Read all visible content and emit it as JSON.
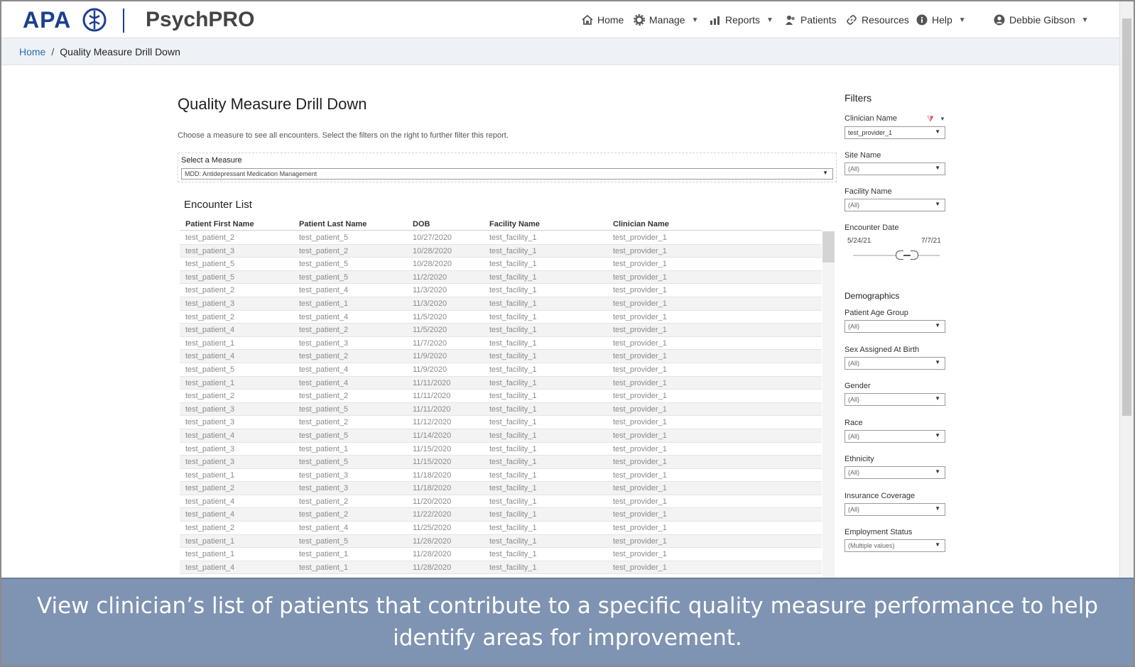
{
  "navbar": {
    "brand_apa": "APA",
    "brand_product": "PsychPRO",
    "items": [
      {
        "label": "Home",
        "icon": "home-icon",
        "dropdown": false
      },
      {
        "label": "Manage",
        "icon": "gear-icon",
        "dropdown": true
      },
      {
        "label": "Reports",
        "icon": "bar-chart-icon",
        "dropdown": true
      },
      {
        "label": "Patients",
        "icon": "users-icon",
        "dropdown": false
      },
      {
        "label": "Resources",
        "icon": "link-icon",
        "dropdown": false
      },
      {
        "label": "Help",
        "icon": "info-icon",
        "dropdown": true
      }
    ],
    "user": {
      "label": "Debbie Gibson",
      "icon": "user-circle-icon"
    }
  },
  "breadcrumb": {
    "home": "Home",
    "separator": "/",
    "current": "Quality Measure Drill Down"
  },
  "main": {
    "title": "Quality Measure Drill Down",
    "description": "Choose a measure to see all encounters. Select the filters on the right to further filter this report.",
    "measure_label": "Select a Measure",
    "measure_value": "MDD: Antidepressant Medication Management",
    "encounter_title": "Encounter List",
    "columns": [
      "Patient First Name",
      "Patient Last Name",
      "DOB",
      "Facility Name",
      "Clinician Name"
    ],
    "rows": [
      [
        "test_patient_2",
        "test_patient_5",
        "10/27/2020",
        "test_facility_1",
        "test_provider_1"
      ],
      [
        "test_patient_3",
        "test_patient_2",
        "10/28/2020",
        "test_facility_1",
        "test_provider_1"
      ],
      [
        "test_patient_5",
        "test_patient_5",
        "10/28/2020",
        "test_facility_1",
        "test_provider_1"
      ],
      [
        "test_patient_5",
        "test_patient_5",
        "11/2/2020",
        "test_facility_1",
        "test_provider_1"
      ],
      [
        "test_patient_2",
        "test_patient_4",
        "11/3/2020",
        "test_facility_1",
        "test_provider_1"
      ],
      [
        "test_patient_3",
        "test_patient_1",
        "11/3/2020",
        "test_facility_1",
        "test_provider_1"
      ],
      [
        "test_patient_2",
        "test_patient_4",
        "11/5/2020",
        "test_facility_1",
        "test_provider_1"
      ],
      [
        "test_patient_4",
        "test_patient_2",
        "11/5/2020",
        "test_facility_1",
        "test_provider_1"
      ],
      [
        "test_patient_1",
        "test_patient_3",
        "11/7/2020",
        "test_facility_1",
        "test_provider_1"
      ],
      [
        "test_patient_4",
        "test_patient_2",
        "11/9/2020",
        "test_facility_1",
        "test_provider_1"
      ],
      [
        "test_patient_5",
        "test_patient_4",
        "11/9/2020",
        "test_facility_1",
        "test_provider_1"
      ],
      [
        "test_patient_1",
        "test_patient_4",
        "11/11/2020",
        "test_facility_1",
        "test_provider_1"
      ],
      [
        "test_patient_2",
        "test_patient_2",
        "11/11/2020",
        "test_facility_1",
        "test_provider_1"
      ],
      [
        "test_patient_3",
        "test_patient_5",
        "11/11/2020",
        "test_facility_1",
        "test_provider_1"
      ],
      [
        "test_patient_3",
        "test_patient_2",
        "11/12/2020",
        "test_facility_1",
        "test_provider_1"
      ],
      [
        "test_patient_4",
        "test_patient_5",
        "11/14/2020",
        "test_facility_1",
        "test_provider_1"
      ],
      [
        "test_patient_3",
        "test_patient_1",
        "11/15/2020",
        "test_facility_1",
        "test_provider_1"
      ],
      [
        "test_patient_3",
        "test_patient_5",
        "11/15/2020",
        "test_facility_1",
        "test_provider_1"
      ],
      [
        "test_patient_1",
        "test_patient_3",
        "11/18/2020",
        "test_facility_1",
        "test_provider_1"
      ],
      [
        "test_patient_2",
        "test_patient_3",
        "11/18/2020",
        "test_facility_1",
        "test_provider_1"
      ],
      [
        "test_patient_4",
        "test_patient_2",
        "11/20/2020",
        "test_facility_1",
        "test_provider_1"
      ],
      [
        "test_patient_4",
        "test_patient_2",
        "11/22/2020",
        "test_facility_1",
        "test_provider_1"
      ],
      [
        "test_patient_2",
        "test_patient_4",
        "11/25/2020",
        "test_facility_1",
        "test_provider_1"
      ],
      [
        "test_patient_1",
        "test_patient_5",
        "11/26/2020",
        "test_facility_1",
        "test_provider_1"
      ],
      [
        "test_patient_1",
        "test_patient_1",
        "11/28/2020",
        "test_facility_1",
        "test_provider_1"
      ],
      [
        "test_patient_4",
        "test_patient_1",
        "11/28/2020",
        "test_facility_1",
        "test_provider_1"
      ]
    ]
  },
  "filters": {
    "title": "Filters",
    "clinician_name": {
      "label": "Clinician Name",
      "value": "test_provider_1"
    },
    "site_name": {
      "label": "Site Name",
      "value": "(All)"
    },
    "facility_name": {
      "label": "Facility Name",
      "value": "(All)"
    },
    "encounter_date": {
      "label": "Encounter Date",
      "from": "5/24/21",
      "to": "7/7/21"
    },
    "demographics_title": "Demographics",
    "patient_age_group": {
      "label": "Patient Age Group",
      "value": "(All)"
    },
    "sex_assigned_at_birth": {
      "label": "Sex Assigned At Birth",
      "value": "(All)"
    },
    "gender": {
      "label": "Gender",
      "value": "(All)"
    },
    "race": {
      "label": "Race",
      "value": "(All)"
    },
    "ethnicity": {
      "label": "Ethnicity",
      "value": "(All)"
    },
    "insurance_coverage": {
      "label": "Insurance Coverage",
      "value": "(All)"
    },
    "employment_status": {
      "label": "Employment Status",
      "value": "(Multiple values)"
    }
  },
  "caption": "View clinician’s list of patients that contribute to a specific quality measure performance to help identify areas for improvement.",
  "colors": {
    "brand_blue": "#1b3f8f",
    "caption_bg": "#7f93b2",
    "link_blue": "#2d6db3"
  }
}
